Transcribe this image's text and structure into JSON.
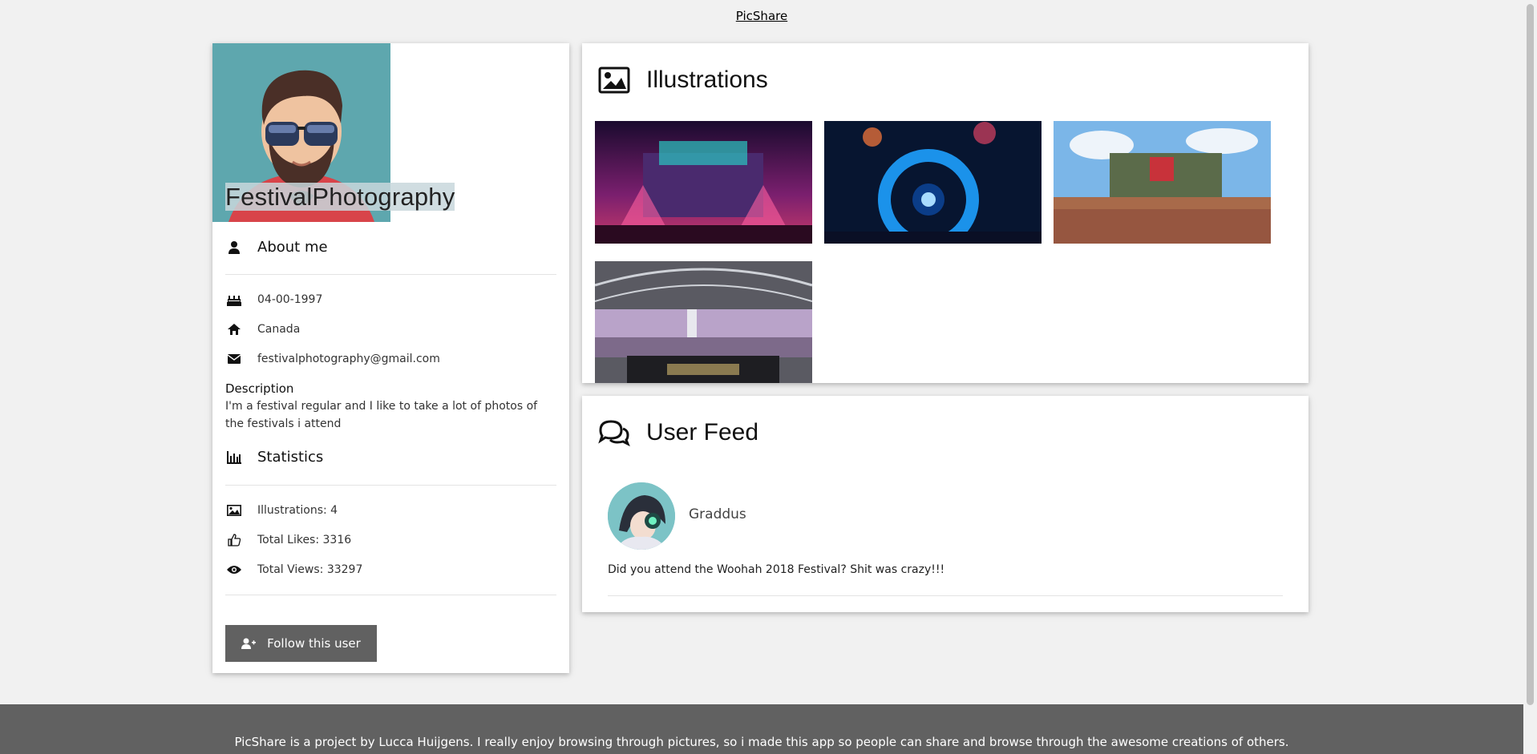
{
  "nav": {
    "brand": "PicShare"
  },
  "profile": {
    "username": "FestivalPhotography",
    "about_title": "About me",
    "birthdate": "04-00-1997",
    "country": "Canada",
    "email": "festivalphotography@gmail.com",
    "description_title": "Description",
    "description": "I'm a festival regular and I like to take a lot of photos of the festivals i attend",
    "statistics_title": "Statistics",
    "illustrations_stat": "Illustrations: 4",
    "likes_stat": "Total Likes: 3316",
    "views_stat": "Total Views: 33297",
    "follow_label": "Follow this user"
  },
  "illustrations": {
    "title": "Illustrations",
    "images": [
      "festival-stage-purple",
      "festival-stage-blue",
      "festival-stage-crowd-day",
      "festival-dj-crowd"
    ]
  },
  "feed": {
    "title": "User Feed",
    "posts": [
      {
        "user": "Graddus",
        "message": "Did you attend the Woohah 2018 Festival? Shit was crazy!!!"
      }
    ]
  },
  "footer": {
    "text": "PicShare is a project by Lucca Huijgens. I really enjoy browsing through pictures, so i made this app so people can share and browse through the awesome creations of others."
  },
  "colors": {
    "avatar_bg": "#5ea7ae",
    "button_bg": "#616161",
    "footer_bg": "#616161"
  }
}
